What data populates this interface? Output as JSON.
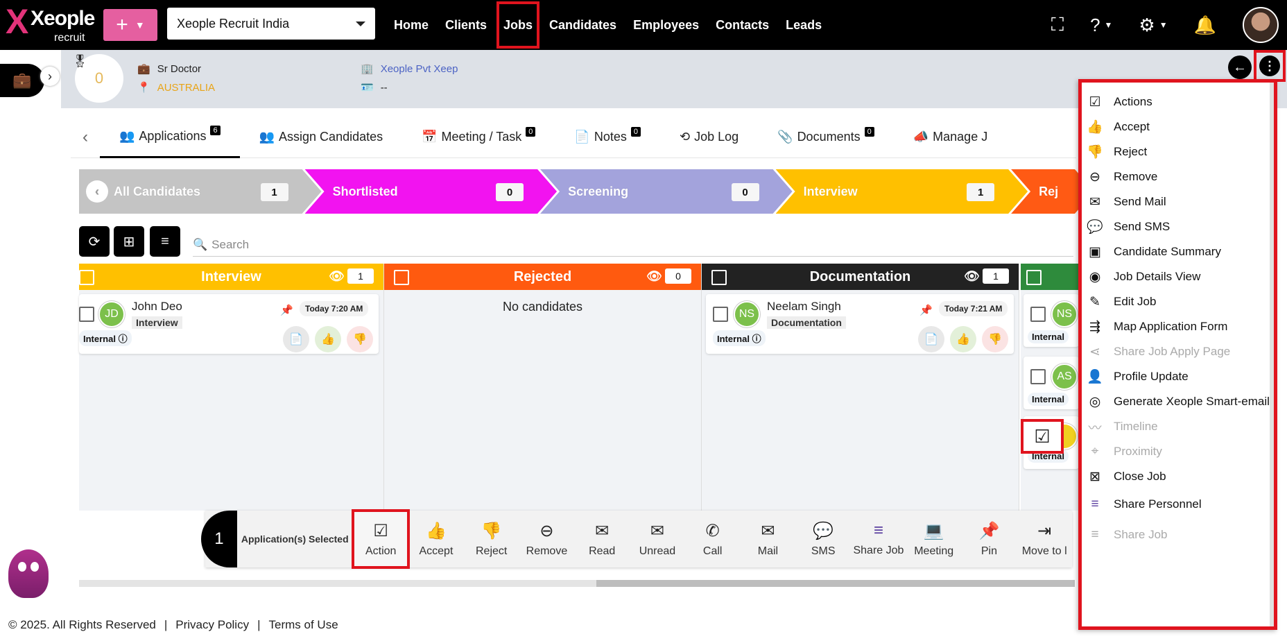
{
  "topbar": {
    "logo_word": "Xeople",
    "logo_sub": "recruit",
    "company": "Xeople Recruit India",
    "nav": [
      "Home",
      "Clients",
      "Jobs",
      "Candidates",
      "Employees",
      "Contacts",
      "Leads"
    ],
    "active_nav": "Jobs"
  },
  "job_header": {
    "score": "0",
    "title": "Sr Doctor",
    "location": "AUSTRALIA",
    "client": "Xeople Pvt Xeep",
    "contact": "--"
  },
  "tabs": [
    {
      "label": "Applications",
      "badge": "6"
    },
    {
      "label": "Assign Candidates",
      "badge": ""
    },
    {
      "label": "Meeting / Task",
      "badge": "0"
    },
    {
      "label": "Notes",
      "badge": "0"
    },
    {
      "label": "Job Log",
      "badge": ""
    },
    {
      "label": "Documents",
      "badge": "0"
    },
    {
      "label": "Manage J",
      "badge": ""
    }
  ],
  "pipeline": [
    {
      "label": "All Candidates",
      "count": "1",
      "color": "#c4c4c4"
    },
    {
      "label": "Shortlisted",
      "count": "0",
      "color": "#f213f0"
    },
    {
      "label": "Screening",
      "count": "0",
      "color": "#a3a3dc"
    },
    {
      "label": "Interview",
      "count": "1",
      "color": "#ffc000"
    },
    {
      "label": "Rej",
      "count": "",
      "color": "#ff5a14"
    }
  ],
  "search": {
    "placeholder": "Search"
  },
  "columns": [
    {
      "title": "Interview",
      "count": "1",
      "color": "#ffc000"
    },
    {
      "title": "Rejected",
      "count": "0",
      "color": "#ff5a0f",
      "empty": "No candidates"
    },
    {
      "title": "Documentation",
      "count": "1",
      "color": "#222222"
    }
  ],
  "cards": {
    "jd": {
      "initials": "JD",
      "name": "John Deo",
      "stage": "Interview",
      "time": "Today 7:20 AM",
      "tag": "Internal"
    },
    "ns": {
      "initials": "NS",
      "name": "Neelam Singh",
      "stage": "Documentation",
      "time": "Today 7:21 AM",
      "tag": "Internal"
    },
    "partial": [
      {
        "initials": "NS",
        "tag": "Internal"
      },
      {
        "initials": "AS",
        "tag": "Internal"
      },
      {
        "initials": "",
        "tag": "Internal"
      }
    ]
  },
  "bulkbar": {
    "count": "1",
    "label": "Application(s) Selected",
    "buttons": [
      "Action",
      "Accept",
      "Reject",
      "Remove",
      "Read",
      "Unread",
      "Call",
      "Mail",
      "SMS",
      "Share Job",
      "Meeting",
      "Pin",
      "Move to l"
    ]
  },
  "footer": {
    "copyright": "© 2025. All Rights Reserved",
    "sep": "|",
    "privacy": "Privacy Policy",
    "terms": "Terms of Use"
  },
  "menu": [
    {
      "label": "Actions",
      "icon": "actions-icon",
      "disabled": false
    },
    {
      "label": "Accept",
      "icon": "thumbs-up-icon",
      "disabled": false
    },
    {
      "label": "Reject",
      "icon": "thumbs-down-icon",
      "disabled": false
    },
    {
      "label": "Remove",
      "icon": "minus-circle-icon",
      "disabled": false
    },
    {
      "label": "Send Mail",
      "icon": "mail-icon",
      "disabled": false
    },
    {
      "label": "Send SMS",
      "icon": "sms-icon",
      "disabled": false
    },
    {
      "label": "Candidate Summary",
      "icon": "summary-icon",
      "disabled": false
    },
    {
      "label": "Job Details View",
      "icon": "job-view-icon",
      "disabled": false
    },
    {
      "label": "Edit Job",
      "icon": "edit-icon",
      "disabled": false
    },
    {
      "label": "Map Application Form",
      "icon": "map-form-icon",
      "disabled": false
    },
    {
      "label": "Share Job Apply Page",
      "icon": "share-icon",
      "disabled": true
    },
    {
      "label": "Profile Update",
      "icon": "profile-update-icon",
      "disabled": false
    },
    {
      "label": "Generate Xeople Smart-email",
      "icon": "smart-email-icon",
      "disabled": false
    },
    {
      "label": "Timeline",
      "icon": "timeline-icon",
      "disabled": true
    },
    {
      "label": "Proximity",
      "icon": "proximity-icon",
      "disabled": true
    },
    {
      "label": "Close Job",
      "icon": "close-job-icon",
      "disabled": false
    },
    {
      "label": "Share Personnel",
      "icon": "share-personnel-icon",
      "disabled": false
    },
    {
      "label": "Share Job",
      "icon": "share-job-icon",
      "disabled": true
    }
  ]
}
